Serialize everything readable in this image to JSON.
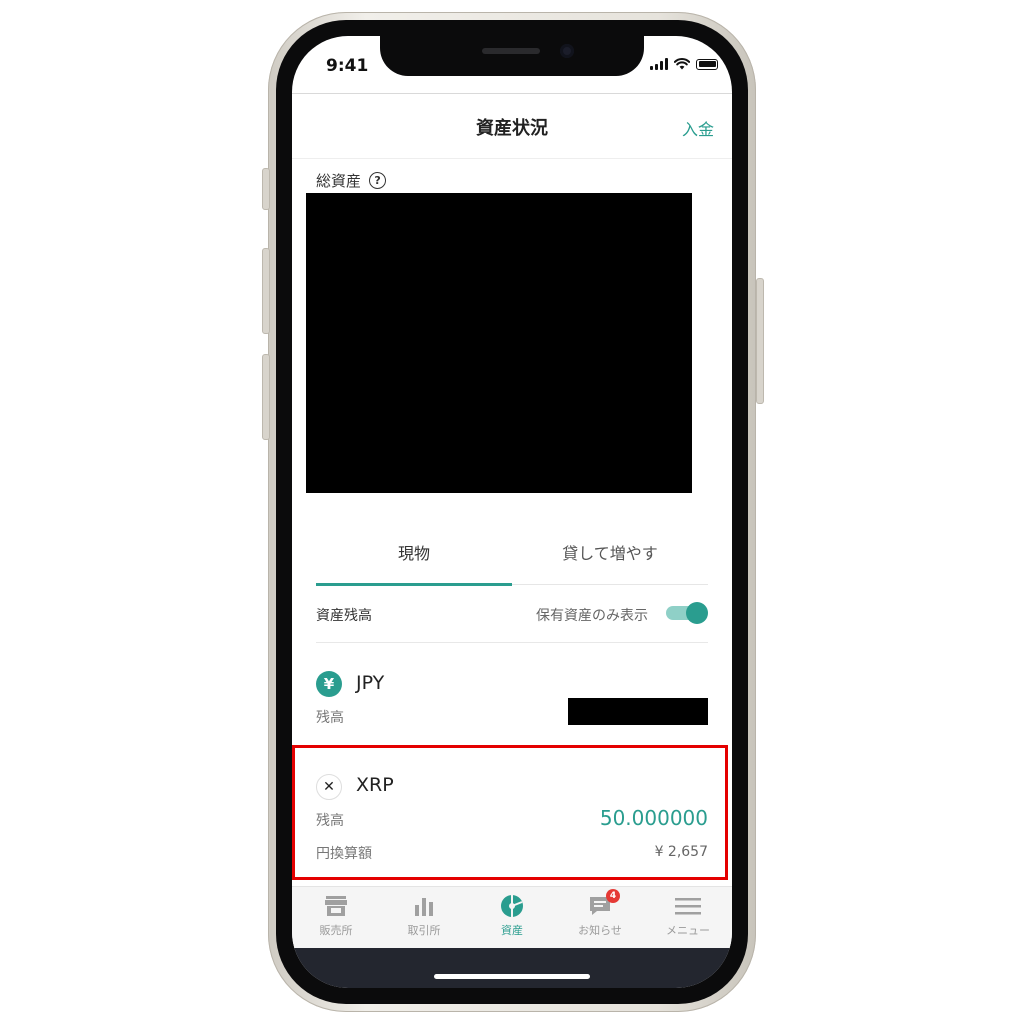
{
  "status": {
    "time": "9:41"
  },
  "header": {
    "title": "資産状況",
    "deposit_label": "入金"
  },
  "total_assets": {
    "label": "総資産",
    "help_glyph": "?"
  },
  "tabs": [
    {
      "label": "現物"
    },
    {
      "label": "貸して増やす"
    }
  ],
  "balance_header": {
    "label": "資産残高",
    "filter_label": "保有資産のみ表示",
    "filter_on": true
  },
  "assets": [
    {
      "symbol": "JPY",
      "icon_glyph": "¥",
      "icon": "yen-icon",
      "balance_label": "残高"
    },
    {
      "symbol": "XRP",
      "icon_glyph": "✕",
      "icon": "xrp-icon",
      "balance_label": "残高",
      "balance": "50.000000",
      "yen_label": "円換算額",
      "yen_value": "¥ 2,657"
    }
  ],
  "nav": [
    {
      "label": "販売所",
      "icon": "store-icon"
    },
    {
      "label": "取引所",
      "icon": "bar-chart-icon"
    },
    {
      "label": "資産",
      "icon": "pie-chart-icon"
    },
    {
      "label": "お知らせ",
      "icon": "message-icon",
      "badge": "4"
    },
    {
      "label": "メニュー",
      "icon": "hamburger-icon"
    }
  ],
  "colors": {
    "accent": "#2a9d8f",
    "highlight": "#e40000",
    "badge": "#e53935"
  }
}
